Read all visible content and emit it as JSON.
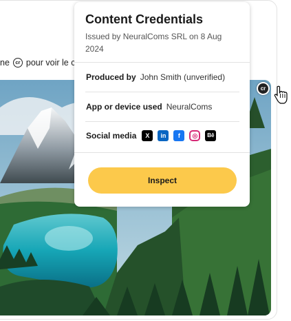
{
  "page": {
    "hint_before": "ne",
    "hint_after": "pour voir le c",
    "cr_icon_text": "cr"
  },
  "popover": {
    "title": "Content Credentials",
    "issued_by": "Issued by NeuralComs SRL on 8 Aug 2024",
    "produced_by_label": "Produced by",
    "produced_by_value": "John Smith (unverified)",
    "app_label": "App or device used",
    "app_value": "NeuralComs",
    "social_label": "Social media",
    "social_icons": [
      {
        "name": "x-icon",
        "glyph": "X",
        "color": "#000000"
      },
      {
        "name": "linkedin-icon",
        "glyph": "in",
        "color": "#0a66c2"
      },
      {
        "name": "facebook-icon",
        "glyph": "f",
        "color": "#1877f2"
      },
      {
        "name": "instagram-icon",
        "glyph": "◎",
        "color": "#d62976"
      },
      {
        "name": "behance-icon",
        "glyph": "Bē",
        "color": "#000000"
      }
    ],
    "inspect_label": "Inspect"
  },
  "colors": {
    "button": "#fcc94b",
    "divider": "#e2e2e2"
  }
}
